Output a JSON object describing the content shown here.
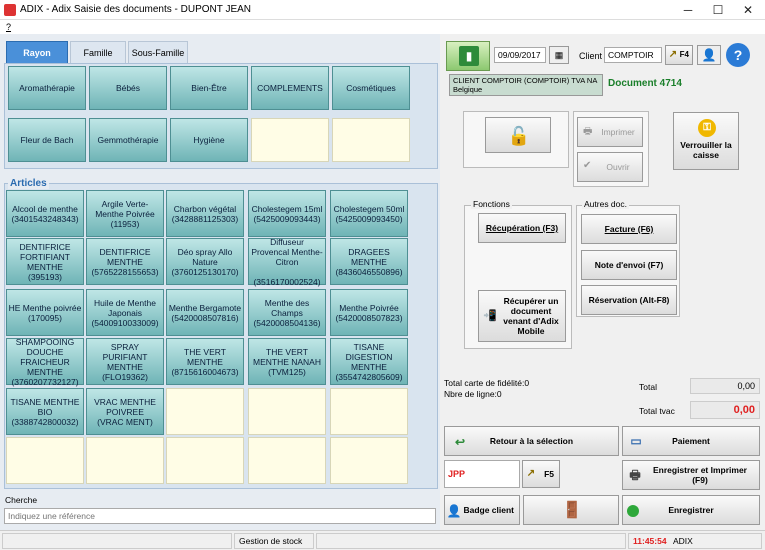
{
  "window": {
    "title": "ADIX - Adix  Saisie des documents - DUPONT JEAN",
    "minimize": "─",
    "maximize": "☐",
    "close": "✕"
  },
  "menu": {
    "item": "?"
  },
  "tabs": [
    "Rayon",
    "Famille",
    "Sous-Famille"
  ],
  "rayon": {
    "row1": [
      "Aromathérapie",
      "Bébés",
      "Bien-Être",
      "COMPLEMENTS",
      "Cosmétiques"
    ],
    "row2": [
      "Fleur de Bach",
      "Gemmothérapie",
      "Hygiène"
    ]
  },
  "articles": {
    "label": "Articles",
    "items": [
      "Alcool de menthe\n(3401543248343)",
      "Argile Verte-Menthe Poivrée\n(11953)",
      "Charbon végétal\n(3428881125303)",
      "Cholestegem 15ml\n(5425009093443)",
      "Cholestegem 50ml\n(5425009093450)",
      "DENTIFRICE FORTIFIANT MENTHE\n(395193)",
      "DENTIFRICE MENTHE\n(5765228155653)",
      "Déo spray Allo Nature\n(3760125130170)",
      "Diffuseur Provencal Menthe-Citron\n\n(3516170002524)",
      "DRAGEES MENTHE\n(8436046550896)",
      "HE Menthe poivrée\n(170095)",
      "Huile de Menthe Japonais\n(5400910033009)",
      "Menthe Bergamote\n(5420008507816)",
      "Menthe des Champs\n(5420008504136)",
      "Menthe Poivrée\n(5420008507823)",
      "SHAMPOOING DOUCHE FRAICHEUR MENTHE\n(3760207732127)",
      "SPRAY PURIFIANT MENTHE\n(FLO19362)",
      "THE VERT MENTHE\n(8715616004673)",
      "THE VERT MENTHE NANAH\n(TVM125)",
      "TISANE DIGESTION MENTHE\n(3554742805609)",
      "TISANE MENTHE BIO\n(3388742800032)",
      "VRAC MENTHE POIVREE\n(VRAC MENT)"
    ]
  },
  "search": {
    "label": "Cherche",
    "placeholder": "Indiquez une référence"
  },
  "header": {
    "date": "09/09/2017",
    "client_label": "Client",
    "client_value": "COMPTOIR",
    "f4": "F4",
    "client_info": "CLIENT COMPTOIR (COMPTOIR) TVA NA\nBelgique",
    "document": "Document 4714"
  },
  "actions": {
    "imprimer": "Imprimer",
    "ouvrir": "Ouvrir",
    "verrouiller": "Verrouiller la caisse"
  },
  "fonctions": {
    "label": "Fonctions",
    "recuperation": "Récupération (F3)",
    "recuperer_adix": "Récupérer un document venant d'Adix Mobile"
  },
  "autres": {
    "label": "Autres doc.",
    "facture": "Facture (F6)",
    "envoi": "Note d'envoi (F7)",
    "reservation": "Réservation (Alt-F8)"
  },
  "totals": {
    "fidelite": "Total carte de fidélité:0",
    "lignes": "Nbre de ligne:0",
    "total_label": "Total",
    "total_value": "0,00",
    "tvac_label": "Total tvac",
    "tvac_value": "0,00"
  },
  "bottom": {
    "retour": "Retour à la sélection",
    "paiement": "Paiement",
    "jpp": "JPP",
    "f5": "F5",
    "enregistrer_imprimer": "Enregistrer et Imprimer\n(F9)",
    "badge": "Badge client",
    "enregistrer": "Enregistrer"
  },
  "status": {
    "stock": "Gestion de stock",
    "time": "11:45:54",
    "user": "ADIX"
  }
}
